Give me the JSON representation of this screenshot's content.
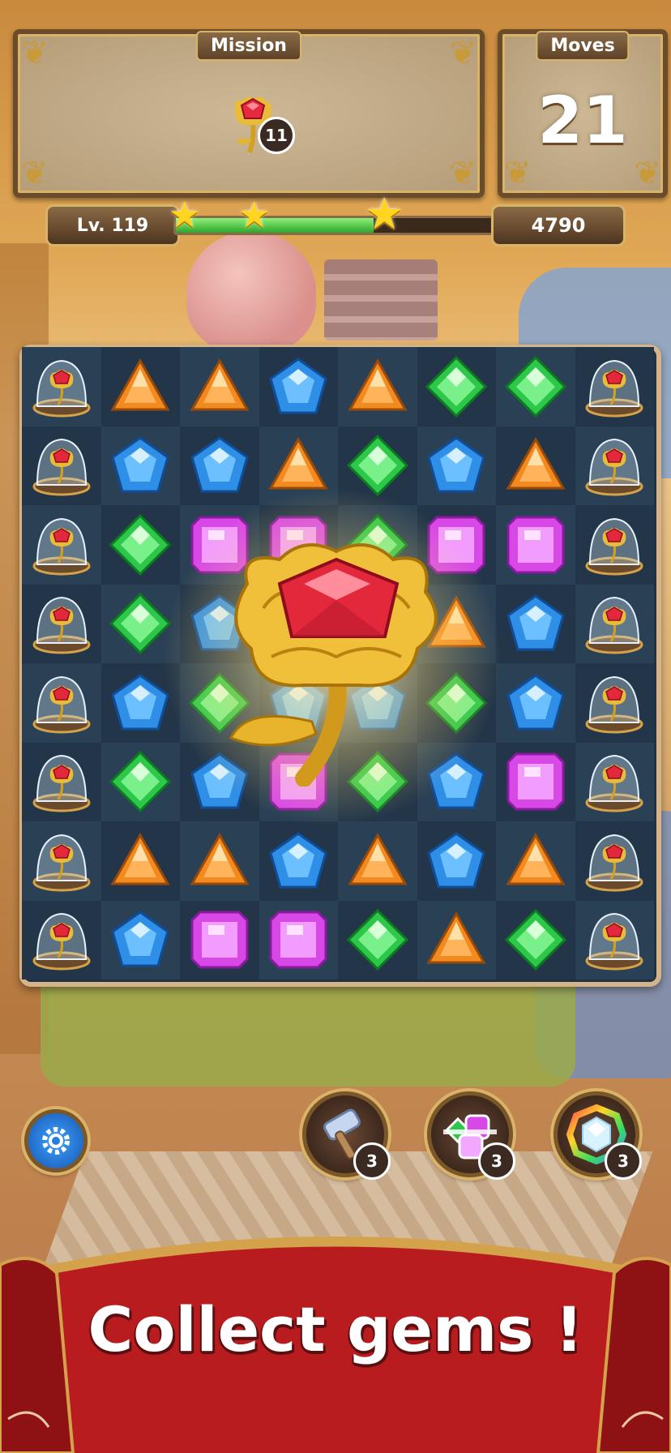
{
  "mission": {
    "title": "Mission",
    "target_icon": "rose-gem-icon",
    "target_count": "11"
  },
  "moves": {
    "title": "Moves",
    "value": "21"
  },
  "progress": {
    "level_label": "Lv. 119",
    "score": "4790",
    "fill_fraction": 0.62,
    "stars_earned": 3
  },
  "board": {
    "rows": 8,
    "cols": 8,
    "grid": [
      [
        "rose",
        "orange",
        "orange",
        "blue",
        "orange",
        "green",
        "green",
        "rose"
      ],
      [
        "rose",
        "blue",
        "blue",
        "orange",
        "green",
        "blue",
        "orange",
        "rose"
      ],
      [
        "rose",
        "green",
        "purple",
        "purple",
        "green",
        "purple",
        "purple",
        "rose"
      ],
      [
        "rose",
        "green",
        "blue",
        "blue",
        "blue",
        "orange",
        "blue",
        "rose"
      ],
      [
        "rose",
        "blue",
        "green",
        "blue",
        "blue",
        "green",
        "blue",
        "rose"
      ],
      [
        "rose",
        "green",
        "blue",
        "purple",
        "green",
        "blue",
        "purple",
        "rose"
      ],
      [
        "rose",
        "orange",
        "orange",
        "blue",
        "orange",
        "blue",
        "orange",
        "rose"
      ],
      [
        "rose",
        "blue",
        "purple",
        "purple",
        "green",
        "orange",
        "green",
        "rose"
      ]
    ],
    "effect_icon": "golden-rose-icon"
  },
  "boosters": [
    {
      "name": "hammer",
      "icon": "hammer-icon",
      "count": "3"
    },
    {
      "name": "cross-blast",
      "icon": "cross-gem-icon",
      "count": "3"
    },
    {
      "name": "color-bomb",
      "icon": "rainbow-diamond-icon",
      "count": "3"
    }
  ],
  "settings": {
    "icon": "gear-icon"
  },
  "banner": {
    "text": "Collect gems !"
  },
  "colors": {
    "orange": "#f28a1f",
    "blue": "#2f8ee6",
    "green": "#2dc84a",
    "purple": "#d848e6",
    "rose": "#e3283c"
  }
}
